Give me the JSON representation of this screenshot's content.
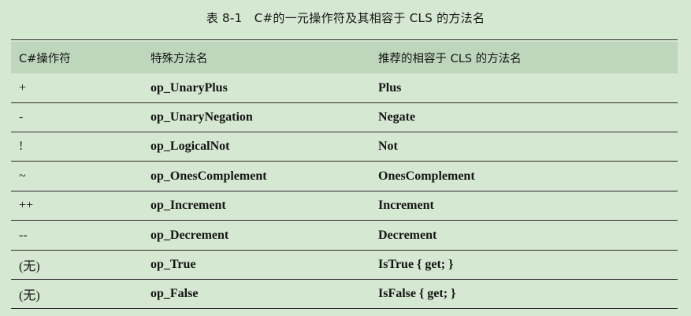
{
  "caption": "表 8-1　C#的一元操作符及其相容于 CLS 的方法名",
  "table": {
    "headers": [
      "C#操作符",
      "特殊方法名",
      "推荐的相容于 CLS 的方法名"
    ],
    "rows": [
      [
        "+",
        "op_UnaryPlus",
        "Plus"
      ],
      [
        "-",
        "op_UnaryNegation",
        "Negate"
      ],
      [
        "!",
        "op_LogicalNot",
        "Not"
      ],
      [
        "~",
        "op_OnesComplement",
        "OnesComplement"
      ],
      [
        "++",
        "op_Increment",
        "Increment"
      ],
      [
        "--",
        "op_Decrement",
        "Decrement"
      ],
      [
        "(无)",
        "op_True",
        "IsTrue { get; }"
      ],
      [
        "(无)",
        "op_False",
        "IsFalse { get; }"
      ]
    ]
  },
  "colors": {
    "page_background": "#d5e8d1",
    "header_background": "#bdd6bc",
    "rule": "#2b2b2b",
    "text": "#151515"
  }
}
